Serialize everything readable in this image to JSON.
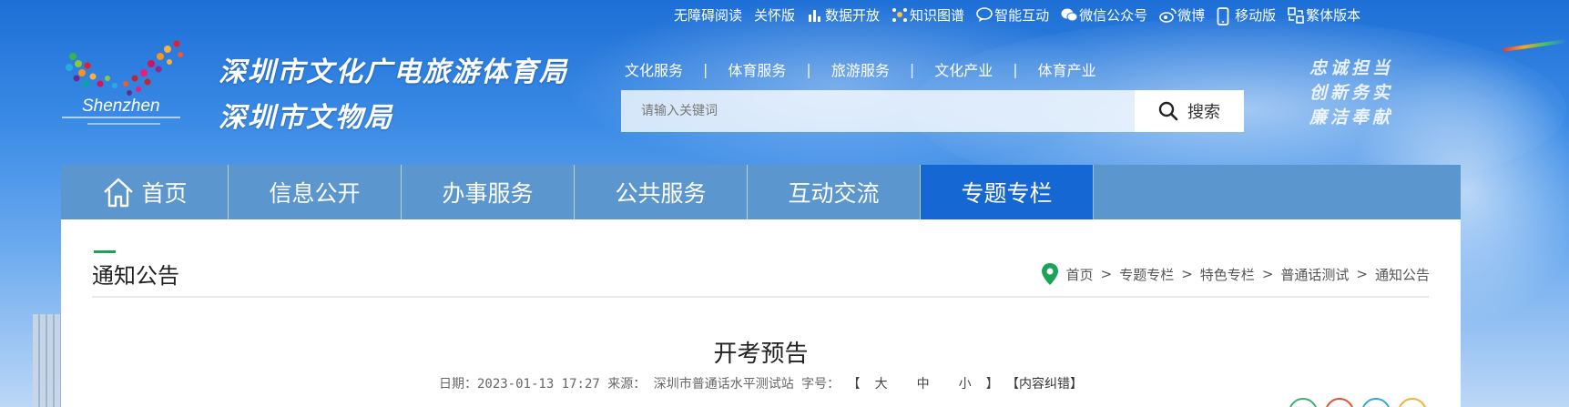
{
  "topbar": {
    "items": [
      {
        "label": "无障碍阅读",
        "icon": ""
      },
      {
        "label": "关怀版",
        "icon": ""
      },
      {
        "label": "数据开放",
        "icon": "bar-chart-icon"
      },
      {
        "label": "知识图谱",
        "icon": "network-icon"
      },
      {
        "label": "智能互动",
        "icon": "chat-bubble-icon"
      },
      {
        "label": "微信公众号",
        "icon": "wechat-icon"
      },
      {
        "label": "微博",
        "icon": "weibo-icon"
      },
      {
        "label": "移动版",
        "icon": "mobile-icon"
      },
      {
        "label": "繁体版本",
        "icon": "traditional-chinese-icon"
      }
    ]
  },
  "logo": {
    "line1": "深圳市文化广电旅游体育局",
    "line2": "深圳市文物局",
    "emblem_text": "Shenzhen"
  },
  "catnav": {
    "items": [
      "文化服务",
      "体育服务",
      "旅游服务",
      "文化产业",
      "体育产业"
    ],
    "separator": "|"
  },
  "search": {
    "placeholder": "请输入关键词",
    "button_label": "搜索"
  },
  "slogan": [
    "忠诚担当",
    "创新务实",
    "廉洁奉献"
  ],
  "mainnav": {
    "tabs": [
      {
        "label": "首页",
        "active": false
      },
      {
        "label": "信息公开",
        "active": false
      },
      {
        "label": "办事服务",
        "active": false
      },
      {
        "label": "公共服务",
        "active": false
      },
      {
        "label": "互动交流",
        "active": false
      },
      {
        "label": "专题专栏",
        "active": true
      }
    ]
  },
  "section": {
    "title": "通知公告"
  },
  "breadcrumb": [
    "首页",
    "专题专栏",
    "特色专栏",
    "普通话测试",
    "通知公告"
  ],
  "article": {
    "title": "开考预告",
    "date_label": "日期：",
    "date": "2023-01-13 17:27",
    "source_label": "来源：",
    "source": "深圳市普通话水平测试站",
    "fontsize_label": "字号：",
    "size_large": "大",
    "size_medium": "中",
    "size_small": "小",
    "error_report": "【内容纠错】"
  },
  "colors": {
    "nav_bg": "#5b96cf",
    "nav_active": "#1567d3",
    "accent_green": "#1ca35a"
  }
}
